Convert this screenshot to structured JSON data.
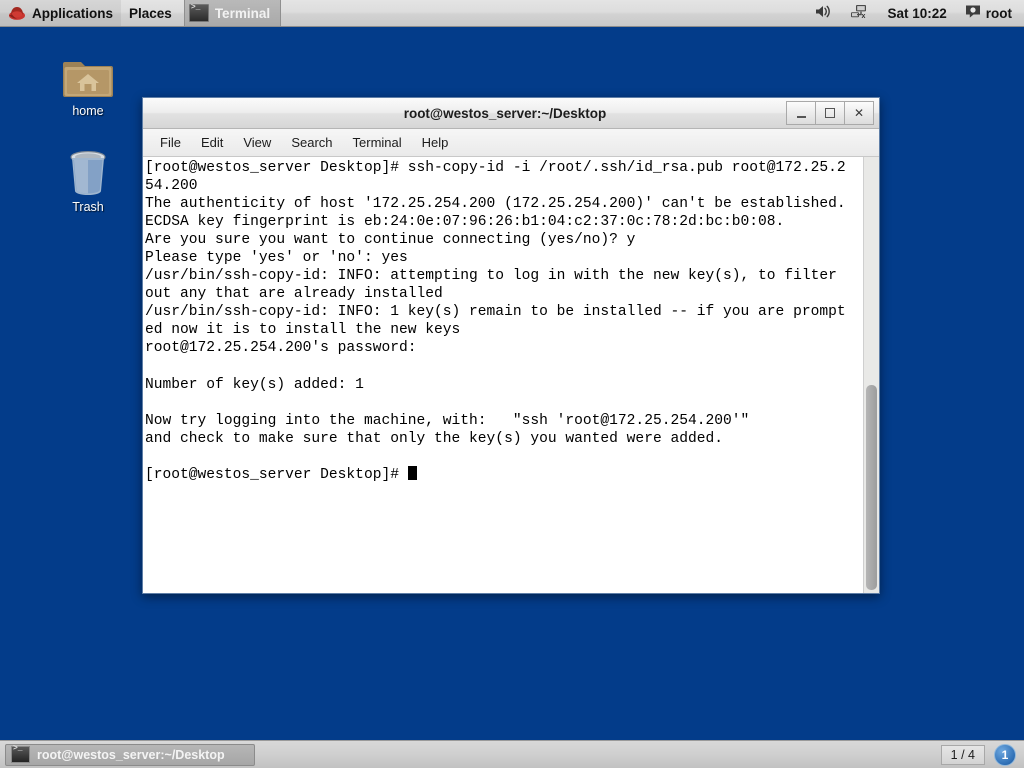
{
  "top_panel": {
    "applications_label": "Applications",
    "places_label": "Places",
    "window_task_label": "Terminal",
    "clock": "Sat 10:22",
    "user_label": "root",
    "icons": {
      "menu_icon": "redhat-logo-icon",
      "terminal_icon": "terminal-icon",
      "volume_icon": "volume-speaker-icon",
      "network_icon": "network-disconnected-icon",
      "user_icon": "user-account-icon"
    }
  },
  "desktop": {
    "background_color": "#033c8a",
    "icons": [
      {
        "name": "home",
        "label": "home",
        "icon": "home-folder-icon"
      },
      {
        "name": "trash",
        "label": "Trash",
        "icon": "trash-can-icon"
      }
    ]
  },
  "terminal_window": {
    "title": "root@westos_server:~/Desktop",
    "window_buttons": {
      "minimize": "–",
      "maximize": "□",
      "close": "✕"
    },
    "menus": [
      "File",
      "Edit",
      "View",
      "Search",
      "Terminal",
      "Help"
    ],
    "content": "[root@westos_server Desktop]# ssh-copy-id -i /root/.ssh/id_rsa.pub root@172.25.2\n54.200\nThe authenticity of host '172.25.254.200 (172.25.254.200)' can't be established.\nECDSA key fingerprint is eb:24:0e:07:96:26:b1:04:c2:37:0c:78:2d:bc:b0:08.\nAre you sure you want to continue connecting (yes/no)? y\nPlease type 'yes' or 'no': yes\n/usr/bin/ssh-copy-id: INFO: attempting to log in with the new key(s), to filter\nout any that are already installed\n/usr/bin/ssh-copy-id: INFO: 1 key(s) remain to be installed -- if you are prompt\ned now it is to install the new keys\nroot@172.25.254.200's password:\n\nNumber of key(s) added: 1\n\nNow try logging into the machine, with:   \"ssh 'root@172.25.254.200'\"\nand check to make sure that only the key(s) you wanted were added.\n\n",
    "prompt_line": "[root@westos_server Desktop]# ",
    "foreground_color": "#000000",
    "background_color": "#ffffff"
  },
  "bottom_panel": {
    "task_label": "root@westos_server:~/Desktop",
    "task_icon": "terminal-icon",
    "workspace_indicator": "1 / 4",
    "workspace_badge": "1"
  }
}
